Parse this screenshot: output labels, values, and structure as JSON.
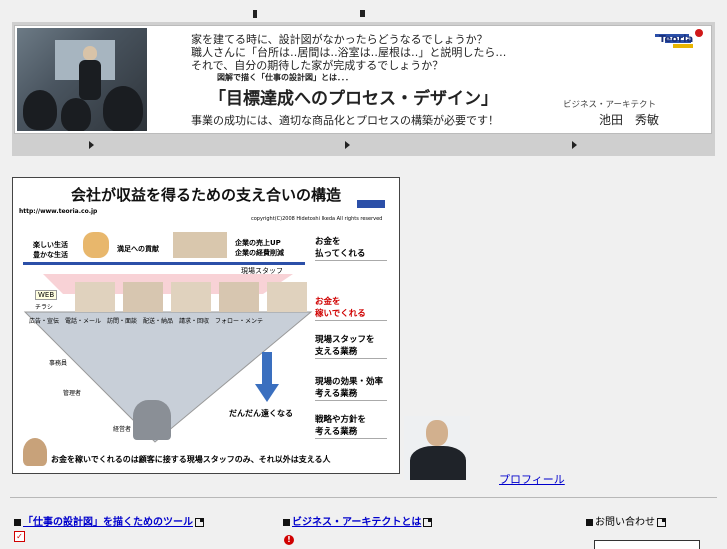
{
  "banner": {
    "line1": "家を建てる時に、設計図がなかったらどうなるでしょうか？",
    "line2": "職人さんに「台所は‥居間は‥浴室は‥屋根は‥」と説明したら…",
    "line3": "それで、自分の期待した家が完成するでしょうか？",
    "subtitle": "図解で描く「仕事の設計図」とは．．．",
    "title": "「目標達成へのプロセス・デザイン」",
    "role": "ビジネス・アーキテクト",
    "author": "池田　秀敏",
    "tagline": "事業の成功には、適切な商品化とプロセスの構築が必要です！",
    "logo_text": "Teoria"
  },
  "diagram": {
    "title": "会社が収益を得るための支え合いの構造",
    "url": "http://www.teoria.co.jp",
    "copyright": "copyright(C)2008 Hidetoshi Ikeda All rights reserved",
    "left_top": "楽しい生活\n豊かな生活",
    "center_top": "満足への貢献",
    "right_top": "企業の売上UP\n企業の経費削減",
    "staff_label": "現場スタッフ",
    "web_label": "WEB",
    "flyer_label": "チラシ",
    "tasks": "広告・宣伝　電話・メール　訪問・面談　配送・納品　請求・回収　フォロー・メンテ",
    "office_label": "事務員",
    "manager_label": "管理者",
    "executive_label": "経営者",
    "farther_label": "だんだん遠くなる",
    "right_boxes": [
      "お金を\n払ってくれる",
      "お金を\n稼いでくれる",
      "現場スタッフを\n支える業務",
      "現場の効果・効率\n考える業務",
      "戦略や方針を\n考える業務"
    ],
    "footer": "お金を稼いでくれるのは顧客に接する現場スタッフのみ、それ以外は支える人"
  },
  "profile_link": "プロフィール",
  "sections": [
    {
      "label": "「仕事の設計図」を描くためのツール"
    },
    {
      "label": "ビジネス・アーキテクトとは"
    },
    {
      "label": "お問い合わせ"
    }
  ],
  "colors": {
    "link": "#0000cc",
    "accent_red": "#d00000",
    "arrow_blue": "#3a6fbf"
  }
}
